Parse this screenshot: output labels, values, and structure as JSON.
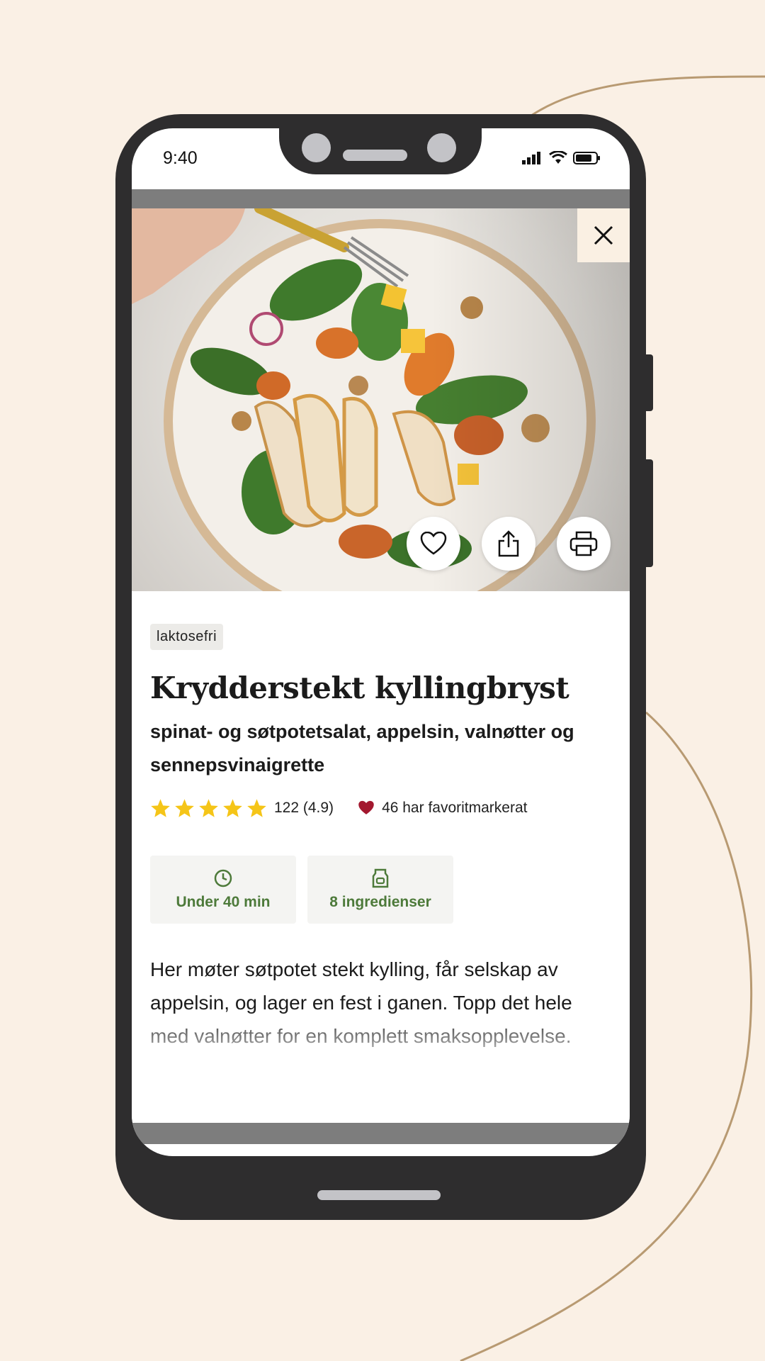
{
  "status_bar": {
    "time": "9:40"
  },
  "recipe": {
    "tag": "laktosefri",
    "title": "Krydderstekt kyllingbryst",
    "subtitle": "spinat- og søtpotetsalat, appelsin, valnøtter og sennepsvinaigrette",
    "rating": {
      "stars": 5,
      "text": "122 (4.9)"
    },
    "favorites_text": "46 har favoritmarkerat",
    "info": {
      "time_label": "Under 40 min",
      "ingredients_label": "8 ingredienser"
    },
    "description": "Her møter søtpotet stekt kylling, får selskap av appelsin, og lager en fest i ganen. Topp det hele med valnøtter for en komplett smaksopplevelse."
  },
  "icons": {
    "close": "close-icon",
    "favorite": "heart-icon",
    "share": "share-icon",
    "print": "printer-icon",
    "clock": "clock-icon",
    "ingredients": "bag-icon",
    "star": "star-icon",
    "heart_filled": "heart-filled-icon"
  },
  "colors": {
    "background": "#faf0e5",
    "star": "#f5c518",
    "heart": "#a3182f",
    "info_text": "#4d7a3a",
    "curve": "#b89a72"
  }
}
